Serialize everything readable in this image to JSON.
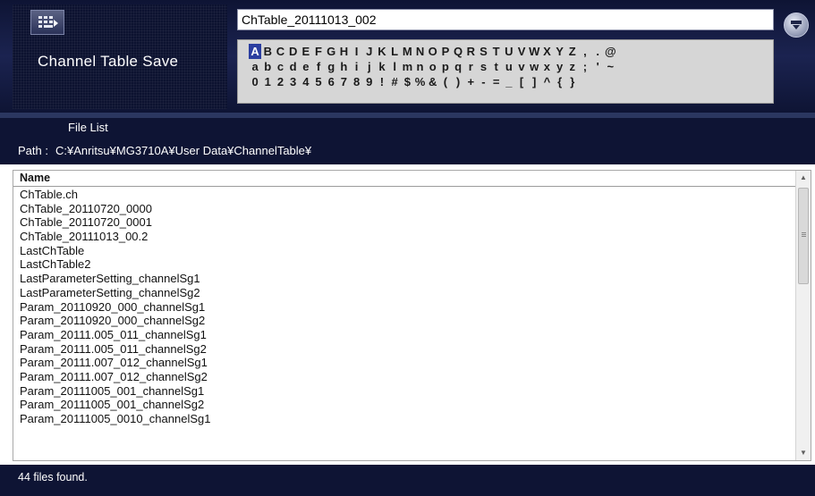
{
  "header": {
    "title": "Channel Table Save",
    "filename_value": "ChTable_20111013_002",
    "keyboard_icon": "keyboard-icon",
    "enter_icon": "download-arrow-icon"
  },
  "char_panel": {
    "selected_char": "A",
    "row1": [
      "A",
      "B",
      "C",
      "D",
      "E",
      "F",
      "G",
      "H",
      "I",
      "J",
      "K",
      "L",
      "M",
      "N",
      "O",
      "P",
      "Q",
      "R",
      "S",
      "T",
      "U",
      "V",
      "W",
      "X",
      "Y",
      "Z",
      ",",
      ".",
      "@"
    ],
    "row2": [
      "a",
      "b",
      "c",
      "d",
      "e",
      "f",
      "g",
      "h",
      "i",
      "j",
      "k",
      "l",
      "m",
      "n",
      "o",
      "p",
      "q",
      "r",
      "s",
      "t",
      "u",
      "v",
      "w",
      "x",
      "y",
      "z",
      ";",
      "'",
      "~"
    ],
    "row3": [
      "0",
      "1",
      "2",
      "3",
      "4",
      "5",
      "6",
      "7",
      "8",
      "9",
      "!",
      "#",
      "$",
      "%",
      "&",
      "(",
      ")",
      "+",
      "-",
      "=",
      "_",
      "[",
      "]",
      "^",
      "{",
      "}"
    ]
  },
  "file_list": {
    "label": "File List",
    "path_label": "Path :",
    "path_value": "C:¥Anritsu¥MG3710A¥User Data¥ChannelTable¥",
    "column_name": "Name",
    "files": [
      "ChTable.ch",
      "ChTable_20110720_0000",
      "ChTable_20110720_0001",
      "ChTable_20111013_00.2",
      "LastChTable",
      "LastChTable2",
      "LastParameterSetting_channelSg1",
      "LastParameterSetting_channelSg2",
      "Param_20110920_000_channelSg1",
      "Param_20110920_000_channelSg2",
      "Param_20111.005_011_channelSg1",
      "Param_20111.005_011_channelSg2",
      "Param_20111.007_012_channelSg1",
      "Param_20111.007_012_channelSg2",
      "Param_20111005_001_channelSg1",
      "Param_20111005_001_channelSg2",
      "Param_20111005_0010_channelSg1"
    ]
  },
  "status": {
    "text": "44 files found."
  }
}
